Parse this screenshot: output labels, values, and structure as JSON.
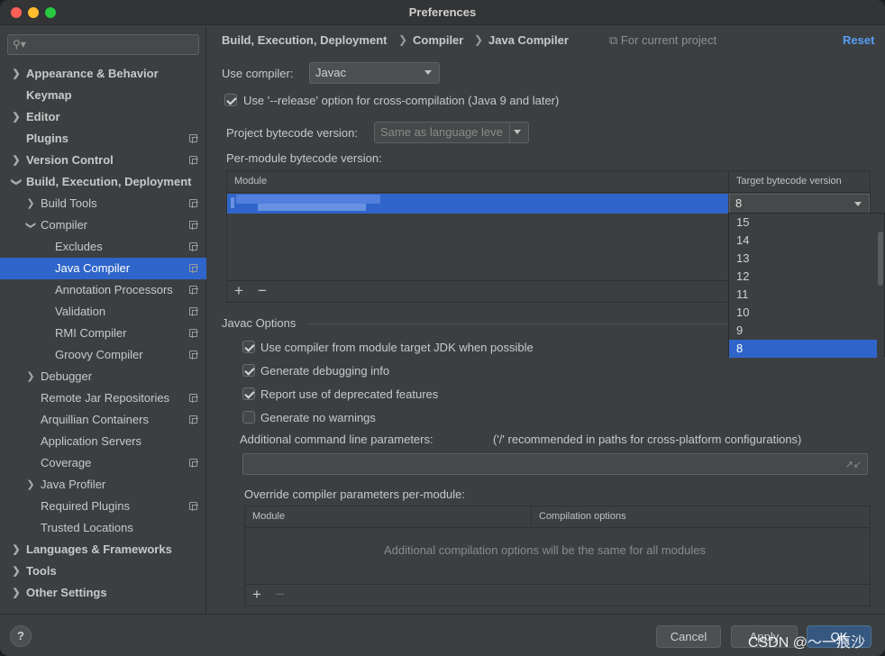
{
  "window": {
    "title": "Preferences"
  },
  "sidebar": {
    "search_placeholder": "",
    "items": [
      {
        "label": "Appearance & Behavior"
      },
      {
        "label": "Keymap"
      },
      {
        "label": "Editor"
      },
      {
        "label": "Plugins"
      },
      {
        "label": "Version Control"
      },
      {
        "label": "Build, Execution, Deployment"
      },
      {
        "label": "Build Tools"
      },
      {
        "label": "Compiler"
      },
      {
        "label": "Excludes"
      },
      {
        "label": "Java Compiler"
      },
      {
        "label": "Annotation Processors"
      },
      {
        "label": "Validation"
      },
      {
        "label": "RMI Compiler"
      },
      {
        "label": "Groovy Compiler"
      },
      {
        "label": "Debugger"
      },
      {
        "label": "Remote Jar Repositories"
      },
      {
        "label": "Arquillian Containers"
      },
      {
        "label": "Application Servers"
      },
      {
        "label": "Coverage"
      },
      {
        "label": "Java Profiler"
      },
      {
        "label": "Required Plugins"
      },
      {
        "label": "Trusted Locations"
      },
      {
        "label": "Languages & Frameworks"
      },
      {
        "label": "Tools"
      },
      {
        "label": "Other Settings"
      }
    ]
  },
  "breadcrumb": {
    "parts": [
      "Build, Execution, Deployment",
      "Compiler",
      "Java Compiler"
    ],
    "scope": "For current project",
    "reset": "Reset"
  },
  "form": {
    "use_compiler_label": "Use compiler:",
    "use_compiler_value": "Javac",
    "release_option_label": "Use '--release' option for cross-compilation (Java 9 and later)",
    "project_bytecode_label": "Project bytecode version:",
    "project_bytecode_placeholder": "Same as language leve",
    "per_module_label": "Per-module bytecode version:"
  },
  "module_table": {
    "headers": [
      "Module",
      "Target bytecode version"
    ],
    "edit_value": "8",
    "dropdown_options": [
      "15",
      "14",
      "13",
      "12",
      "11",
      "10",
      "9",
      "8"
    ],
    "selected_option": "8"
  },
  "javac": {
    "section_title": "Javac Options",
    "options": [
      {
        "label": "Use compiler from module target JDK when possible",
        "checked": true
      },
      {
        "label": "Generate debugging info",
        "checked": true
      },
      {
        "label": "Report use of deprecated features",
        "checked": true
      },
      {
        "label": "Generate no warnings",
        "checked": false
      }
    ],
    "cmdline_label": "Additional command line parameters:",
    "cmdline_hint": "('/' recommended in paths for cross-platform configurations)",
    "override_label": "Override compiler parameters per-module:",
    "override_headers": [
      "Module",
      "Compilation options"
    ],
    "override_empty": "Additional compilation options will be the same for all modules"
  },
  "footer": {
    "help": "?",
    "cancel": "Cancel",
    "apply": "Apply",
    "ok": "OK",
    "watermark": "CSDN @～一痕沙"
  }
}
